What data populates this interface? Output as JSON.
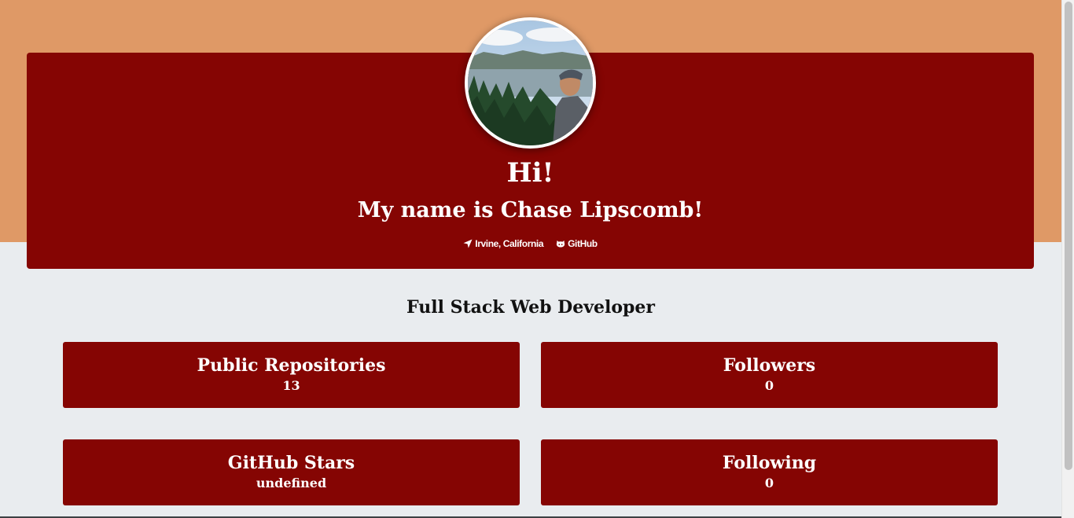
{
  "header": {
    "greeting": "Hi!",
    "name_line": "My name is Chase Lipscomb!",
    "location": "Irvine, California",
    "github_link": "GitHub"
  },
  "role": "Full Stack Web Developer",
  "stats": [
    {
      "label": "Public Repositories",
      "value": "13"
    },
    {
      "label": "Followers",
      "value": "0"
    },
    {
      "label": "GitHub Stars",
      "value": "undefined"
    },
    {
      "label": "Following",
      "value": "0"
    }
  ],
  "icons": {
    "location": "location-arrow-icon",
    "github": "github-icon"
  },
  "colors": {
    "top_band": "#df9966",
    "card": "#850503",
    "page_bg": "#e9ecef",
    "text_on_card": "#ffffff"
  }
}
